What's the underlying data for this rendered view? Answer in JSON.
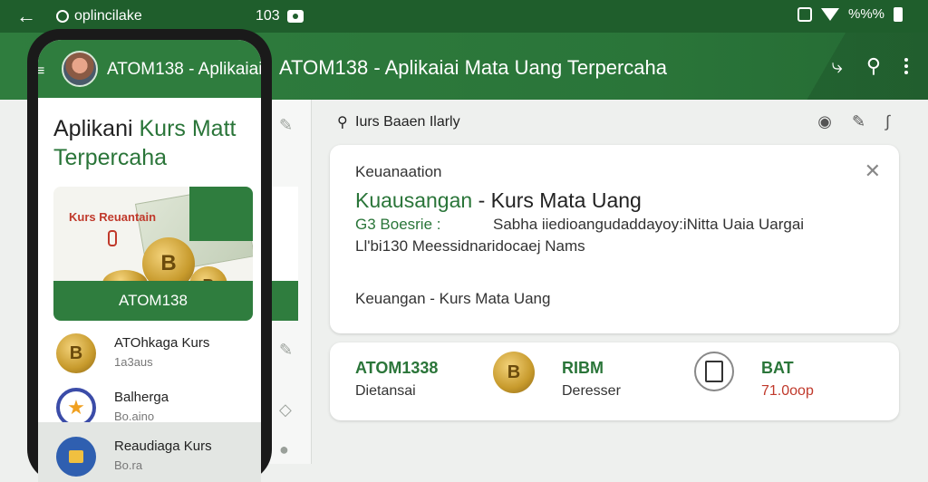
{
  "status_bar": {
    "app_name": "oplincilake",
    "time": "103",
    "right_text": "%%%"
  },
  "app_bar": {
    "title": "ATOM138 - Aplikaiai Mata Uang Terpercaha"
  },
  "phone": {
    "title": "ATOM138 - Aplikaiai",
    "heading_line1_a": "Aplikani ",
    "heading_line1_b": "Kurs Matt",
    "heading_line2": "Terpercaha",
    "card": {
      "label": "Kurs Reuantain",
      "coin_symbol": "B",
      "band_text": "ATOM138"
    },
    "items": [
      {
        "title": "ATOhkaga Kurs",
        "subtitle": "1a3aus"
      },
      {
        "title": "Balherga",
        "subtitle": "Bo.aino"
      },
      {
        "title": "Reaudiaga Kurs",
        "subtitle": "Bo.ra"
      }
    ]
  },
  "search": {
    "text": "Iurs Baaen Ilarly"
  },
  "card1": {
    "label": "Keuanaation",
    "headline_green": "Kuausangan",
    "headline_rest": " - Kurs Mata Uang",
    "row_a_left": "G3 Boesrie    :",
    "row_a_right": "Sabha iiedioangudaddayoy:iNitta Uaia Uargai",
    "row_b": "Ll'bi130 Meessidnaridocaej Nams",
    "footer": "Keuangan - Kurs Mata Uang"
  },
  "card2": {
    "stats": [
      {
        "value": "ATOM1338",
        "sub": "Dietansai"
      },
      {
        "value": "RIBM",
        "sub": "Deresser"
      },
      {
        "value": "BAT",
        "sub": "71.0oop"
      }
    ],
    "coin_symbol": "B"
  },
  "colors": {
    "primary_green": "#2f7d3e",
    "dark_green": "#1f5e2c",
    "accent_red": "#c0392b"
  }
}
